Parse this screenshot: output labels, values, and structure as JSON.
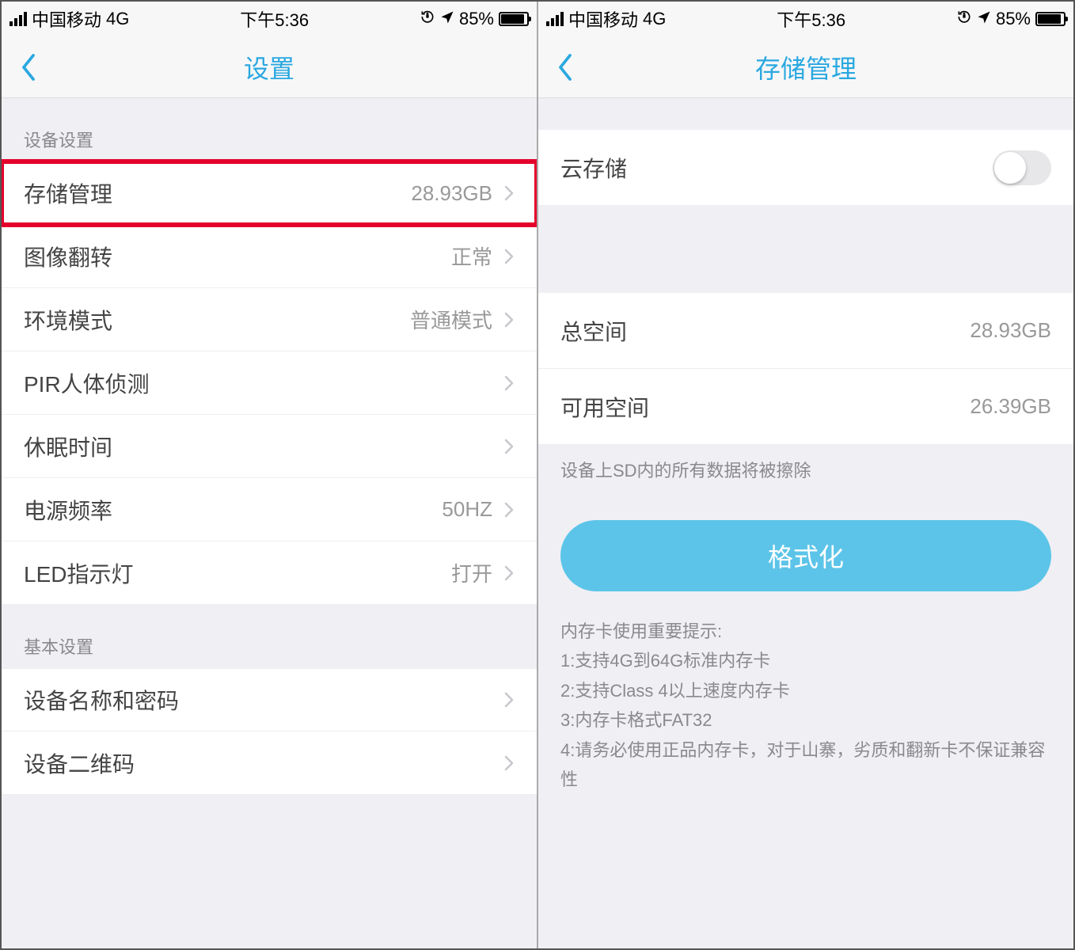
{
  "status": {
    "carrier": "中国移动",
    "network": "4G",
    "time": "下午5:36",
    "battery_pct": "85%"
  },
  "left": {
    "title": "设置",
    "section1_header": "设备设置",
    "rows1": [
      {
        "label": "存储管理",
        "value": "28.93GB",
        "highlight": true
      },
      {
        "label": "图像翻转",
        "value": "正常"
      },
      {
        "label": "环境模式",
        "value": "普通模式"
      },
      {
        "label": "PIR人体侦测",
        "value": ""
      },
      {
        "label": "休眠时间",
        "value": ""
      },
      {
        "label": "电源频率",
        "value": "50HZ"
      },
      {
        "label": "LED指示灯",
        "value": "打开"
      }
    ],
    "section2_header": "基本设置",
    "rows2": [
      {
        "label": "设备名称和密码",
        "value": ""
      },
      {
        "label": "设备二维码",
        "value": ""
      }
    ]
  },
  "right": {
    "title": "存储管理",
    "cloud_label": "云存储",
    "cloud_on": false,
    "total_label": "总空间",
    "total_value": "28.93GB",
    "free_label": "可用空间",
    "free_value": "26.39GB",
    "erase_note": "设备上SD内的所有数据将被擦除",
    "format_button": "格式化",
    "tips_title": "内存卡使用重要提示:",
    "tips_1": "1:支持4G到64G标准内存卡",
    "tips_2": "2:支持Class 4以上速度内存卡",
    "tips_3": "3:内存卡格式FAT32",
    "tips_4": "4:请务必使用正品内存卡，对于山寨，劣质和翻新卡不保证兼容性"
  }
}
